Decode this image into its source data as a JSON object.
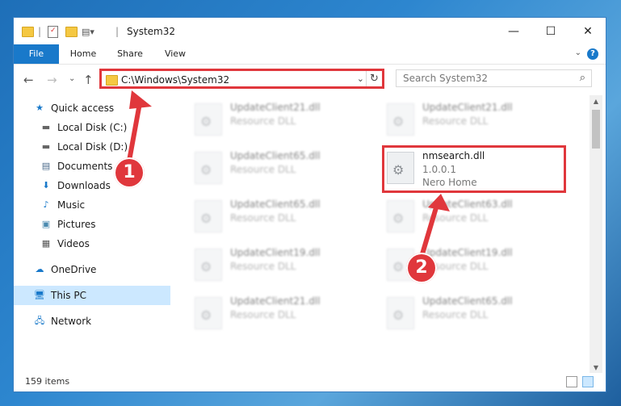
{
  "window": {
    "title": "System32"
  },
  "ribbon": {
    "tabs": [
      "File",
      "Home",
      "Share",
      "View"
    ],
    "help": "?"
  },
  "nav": {
    "address": "C:\\Windows\\System32",
    "search_placeholder": "Search System32",
    "back": "←",
    "forward": "→",
    "recent": "⌄",
    "up": "↑",
    "address_dropdown": "⌄",
    "refresh": "↻",
    "search_icon": "⌕"
  },
  "sidebar": {
    "items": [
      {
        "label": "Quick access",
        "icon": "star-icon"
      },
      {
        "label": "Local Disk (C:)",
        "icon": "drive-icon"
      },
      {
        "label": "Local Disk (D:)",
        "icon": "drive-icon"
      },
      {
        "label": "Documents",
        "icon": "documents-icon"
      },
      {
        "label": "Downloads",
        "icon": "download-icon"
      },
      {
        "label": "Music",
        "icon": "music-icon"
      },
      {
        "label": "Pictures",
        "icon": "pictures-icon"
      },
      {
        "label": "Videos",
        "icon": "videos-icon"
      },
      {
        "label": "OneDrive",
        "icon": "cloud-icon"
      },
      {
        "label": "This PC",
        "icon": "computer-icon"
      },
      {
        "label": "Network",
        "icon": "network-icon"
      }
    ]
  },
  "files": [
    {
      "name": "UpdateClient21.dll",
      "type": "Resource DLL"
    },
    {
      "name": "UpdateClient21.dll",
      "type": "Resource DLL"
    },
    {
      "name": "UpdateClient65.dll",
      "type": "Resource DLL"
    },
    {
      "name": "nmsearch.dll",
      "version": "1.0.0.1",
      "company": "Nero Home"
    },
    {
      "name": "UpdateClient65.dll",
      "type": "Resource DLL"
    },
    {
      "name": "UpdateClient63.dll",
      "type": "Resource DLL"
    },
    {
      "name": "UpdateClient19.dll",
      "type": "Resource DLL"
    },
    {
      "name": "UpdateClient19.dll",
      "type": "Resource DLL"
    },
    {
      "name": "UpdateClient21.dll",
      "type": "Resource DLL"
    },
    {
      "name": "UpdateClient65.dll",
      "type": "Resource DLL"
    }
  ],
  "status": {
    "item_count": "159 items"
  },
  "annotations": {
    "badge1": "1",
    "badge2": "2",
    "color": "#e0373c"
  },
  "colors": {
    "accent": "#1979ca",
    "highlight": "#e0373c",
    "selected": "#cce8ff"
  }
}
